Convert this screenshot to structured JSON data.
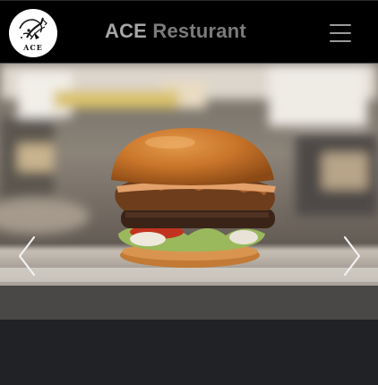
{
  "header": {
    "logo_text": "ACE",
    "brand_primary": "ACE",
    "brand_secondary": " Resturant",
    "menu_icon": "hamburger-icon"
  },
  "hero": {
    "image_subject": "gourmet burger on a metal tray",
    "prev_icon": "chevron-left-icon",
    "next_icon": "chevron-right-icon"
  },
  "colors": {
    "topbar_bg": "#000000",
    "brand_primary": "#a6a6a6",
    "brand_secondary": "#7b7b7b",
    "page_bg": "#202226"
  }
}
